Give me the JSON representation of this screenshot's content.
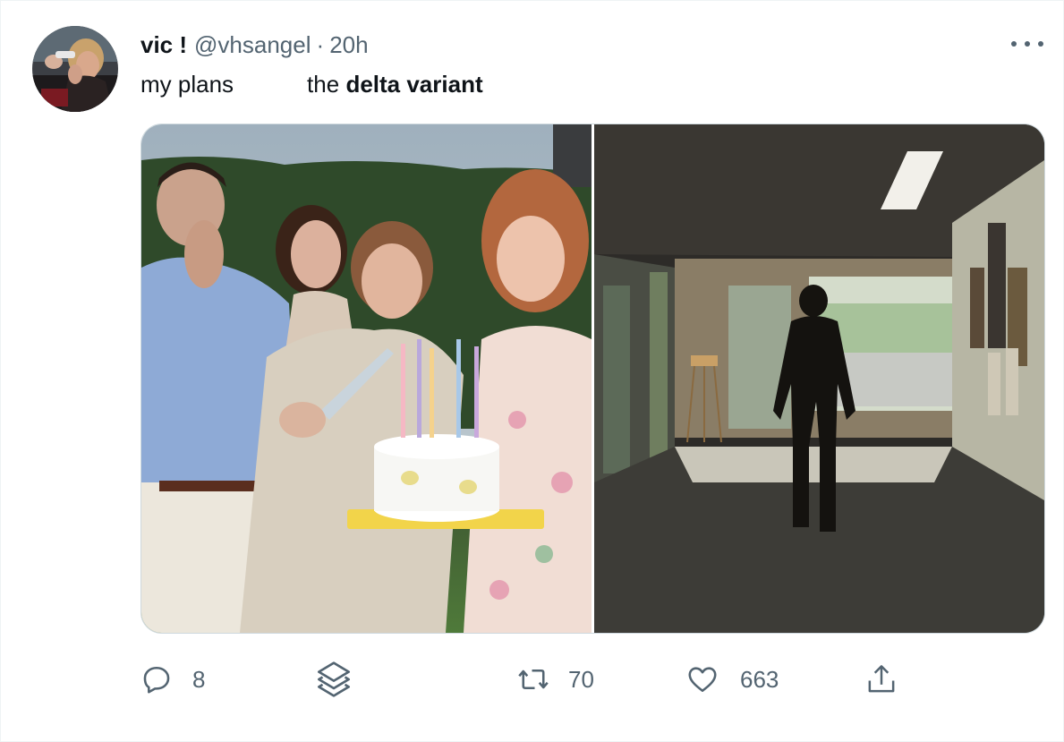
{
  "tweet": {
    "display_name": "vic !",
    "handle": "@vhsangel",
    "separator": "·",
    "time": "20h",
    "text_part1": "my plans",
    "text_part2": "the",
    "text_bold": "delta variant"
  },
  "media": {
    "left_image": "birthday-party-photo",
    "right_image": "man-walking-in-hallway-photo"
  },
  "actions": {
    "reply_count": "8",
    "retweet_count": "70",
    "like_count": "663"
  },
  "icons": {
    "reply": "speech-bubble-icon",
    "stack": "layers-icon",
    "retweet": "retweet-icon",
    "like": "heart-icon",
    "share": "share-icon",
    "more": "more-options-icon"
  },
  "colors": {
    "text": "#0f1419",
    "secondary": "#536471",
    "border": "#cfd9de"
  }
}
